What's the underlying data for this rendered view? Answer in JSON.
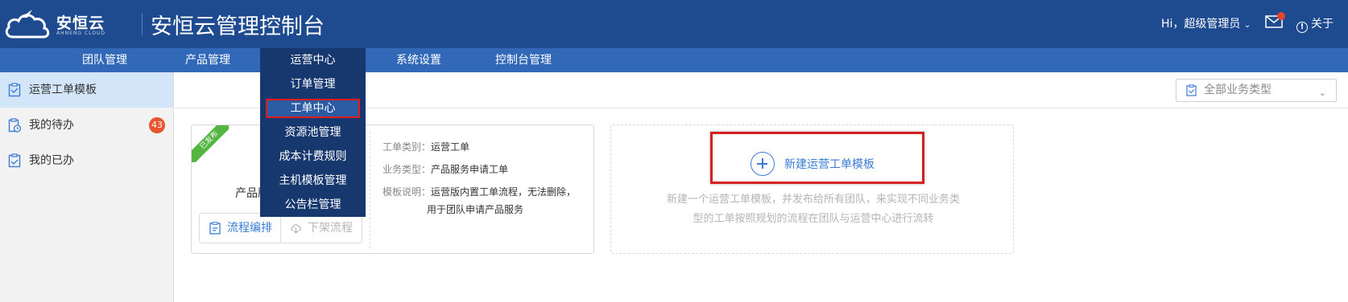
{
  "header": {
    "logo_text": "安恒云",
    "logo_sub": "AHNENG CLOUD",
    "title": "安恒云管理控制台",
    "user_label": "Hi，超级管理员",
    "about_label": "关于"
  },
  "nav": {
    "items": [
      {
        "label": "团队管理"
      },
      {
        "label": "产品管理"
      },
      {
        "label": "运营中心"
      },
      {
        "label": "系统设置"
      },
      {
        "label": "控制台管理"
      }
    ],
    "active": "运营中心"
  },
  "dropdown": {
    "items": [
      {
        "label": "订单管理"
      },
      {
        "label": "工单中心"
      },
      {
        "label": "资源池管理"
      },
      {
        "label": "成本计费规则"
      },
      {
        "label": "主机模板管理"
      },
      {
        "label": "公告栏管理"
      }
    ],
    "highlighted": "工单中心"
  },
  "sidebar": {
    "items": [
      {
        "label": "运营工单模板"
      },
      {
        "label": "我的待办",
        "badge": "43"
      },
      {
        "label": "我的已办"
      }
    ],
    "active": "运营工单模板"
  },
  "filter": {
    "selected": "全部业务类型"
  },
  "template_card": {
    "status": "已发布",
    "name_partial": "产品服",
    "edit_label": "流程编排",
    "offline_label": "下架流程",
    "fields": [
      {
        "key": "工单类别：",
        "value": "运营工单"
      },
      {
        "key": "业务类型：",
        "value": "产品服务申请工单"
      },
      {
        "key": "模板说明：",
        "value": "运营版内置工单流程，无法删除，"
      }
    ],
    "desc_line2": "用于团队申请产品服务"
  },
  "new_card": {
    "label": "新建运营工单模板",
    "desc_line1": "新建一个运营工单模板，并发布给所有团队，来实现不同业务类",
    "desc_line2": "型的工单按照规划的流程在团队与运营中心进行流转"
  },
  "colors": {
    "header_bg": "#1e4a8f",
    "nav_bg": "#3169b8",
    "dropdown_bg": "#17386e",
    "accent": "#3a7bd5",
    "highlight_border": "#d42222",
    "badge": "#e8542e",
    "published": "#52b640"
  }
}
